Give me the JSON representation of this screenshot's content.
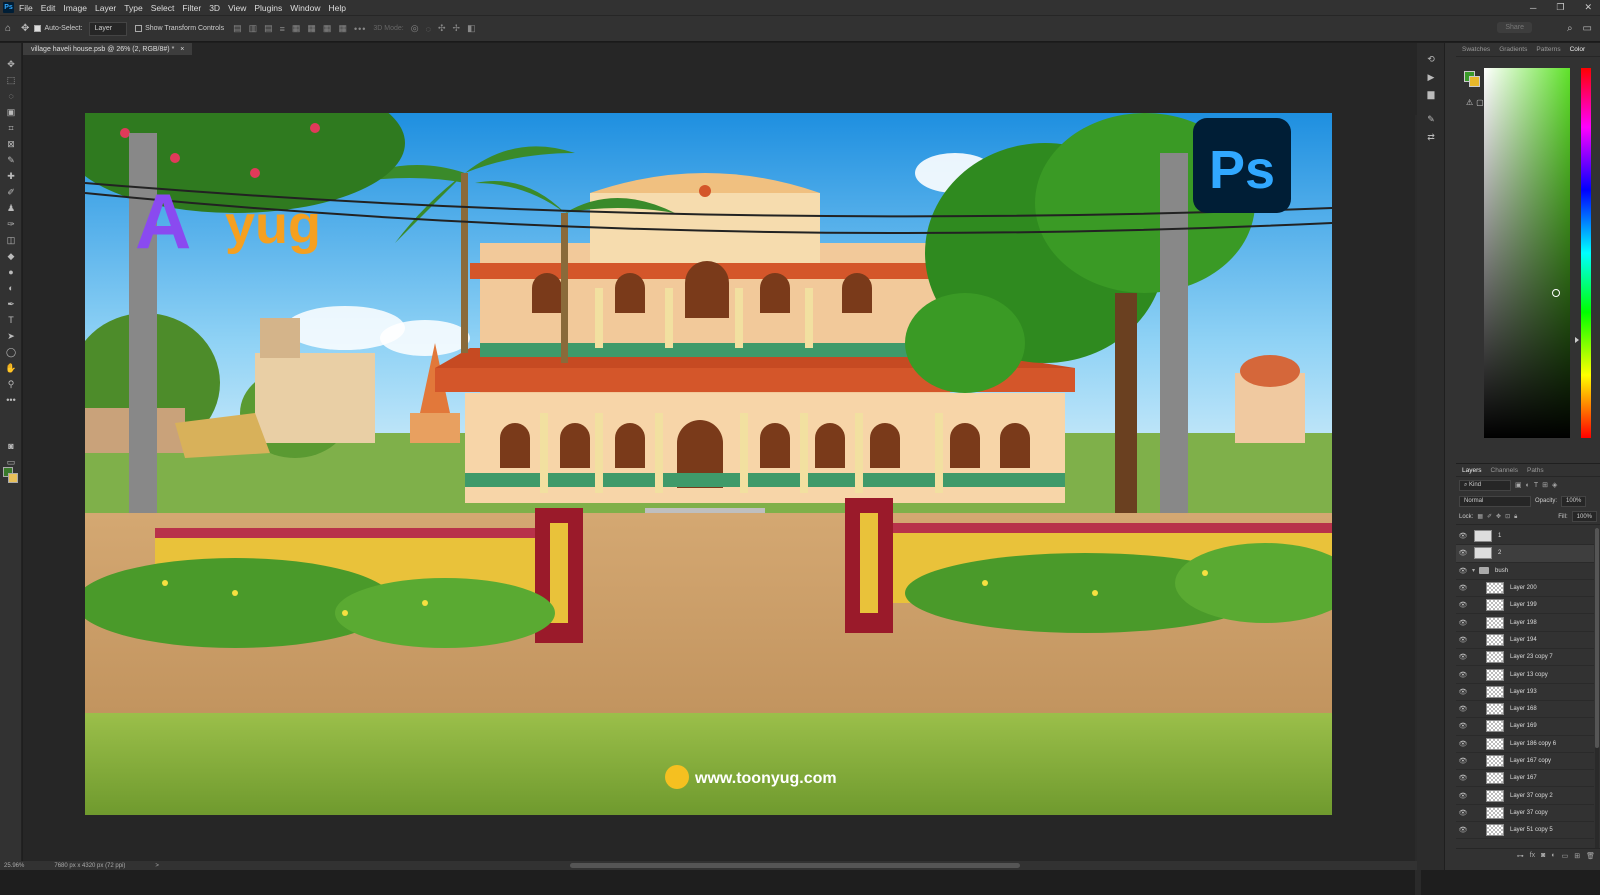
{
  "app": {
    "logo": "Ps"
  },
  "menu": [
    "File",
    "Edit",
    "Image",
    "Layer",
    "Type",
    "Select",
    "Filter",
    "3D",
    "View",
    "Plugins",
    "Window",
    "Help"
  ],
  "window_controls": [
    "─",
    "❐",
    "✕"
  ],
  "options": {
    "auto_select_label": "Auto-Select:",
    "auto_select_value": "Layer",
    "transform_label": "Show Transform Controls",
    "mode_3d": "3D Mode:",
    "share": "Share"
  },
  "document": {
    "tab_title": "village haveli house.psb @ 26% (2, RGB/8#) *",
    "close": "×"
  },
  "status": {
    "zoom": "25.96%",
    "size": "7680 px x 4320 px (72 ppi)",
    "arrow": ">"
  },
  "artwork": {
    "brand_text": "yug",
    "brand_letter": "A",
    "ps_badge": "Ps",
    "website": "www.toonyug.com"
  },
  "color_panel": {
    "tabs": [
      "Swatches",
      "Gradients",
      "Patterns",
      "Color"
    ],
    "active_tab": "Color",
    "foreground": "#3a9a2a",
    "background": "#e8b82a",
    "hue_color": "#5fe22a"
  },
  "layers_panel": {
    "tabs": [
      "Layers",
      "Channels",
      "Paths"
    ],
    "active_tab": "Layers",
    "filter": "Kind",
    "blend_mode": "Normal",
    "opacity_label": "Opacity:",
    "opacity": "100%",
    "lock_label": "Lock:",
    "fill_label": "Fill:",
    "fill": "100%",
    "layers": [
      {
        "name": "1",
        "kind": "top"
      },
      {
        "name": "2",
        "kind": "top",
        "selected": true
      },
      {
        "name": "bush",
        "kind": "group"
      },
      {
        "name": "Layer 200"
      },
      {
        "name": "Layer 199"
      },
      {
        "name": "Layer 198"
      },
      {
        "name": "Layer 194"
      },
      {
        "name": "Layer 23 copy 7"
      },
      {
        "name": "Layer 13 copy"
      },
      {
        "name": "Layer 193"
      },
      {
        "name": "Layer 168"
      },
      {
        "name": "Layer 169"
      },
      {
        "name": "Layer 186 copy 6"
      },
      {
        "name": "Layer 167 copy"
      },
      {
        "name": "Layer 167"
      },
      {
        "name": "Layer 37 copy 2"
      },
      {
        "name": "Layer 37 copy"
      },
      {
        "name": "Layer 51 copy 5"
      }
    ]
  }
}
